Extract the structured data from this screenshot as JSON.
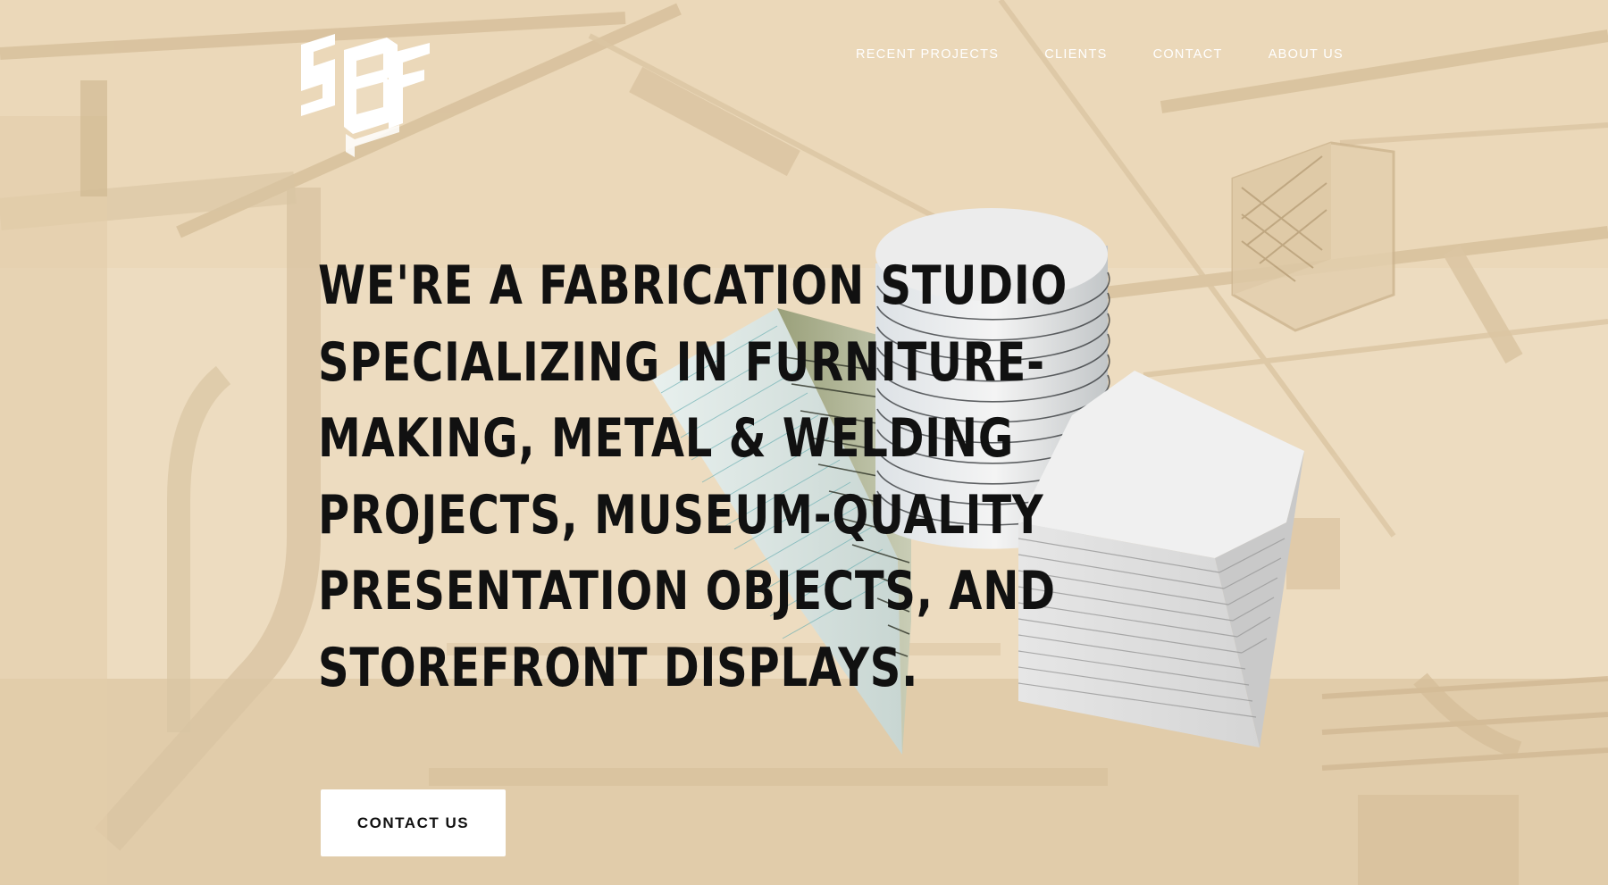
{
  "brand": {
    "logo_alt": "SBF",
    "accent_bg": "#eddcc0",
    "text_color": "#111111"
  },
  "nav": {
    "items": [
      {
        "label": "RECENT PROJECTS"
      },
      {
        "label": "CLIENTS"
      },
      {
        "label": "CONTACT"
      },
      {
        "label": "ABOUT US"
      }
    ]
  },
  "hero": {
    "headline_lines": [
      "WE'RE A FABRICATION STUDIO",
      "SPECIALIZING IN FURNITURE-",
      "MAKING, METAL & WELDING",
      "PROJECTS, MUSEUM-QUALITY",
      "PRESENTATION OBJECTS, AND",
      "STOREFRONT DISPLAYS."
    ],
    "cta_label": "CONTACT US"
  }
}
